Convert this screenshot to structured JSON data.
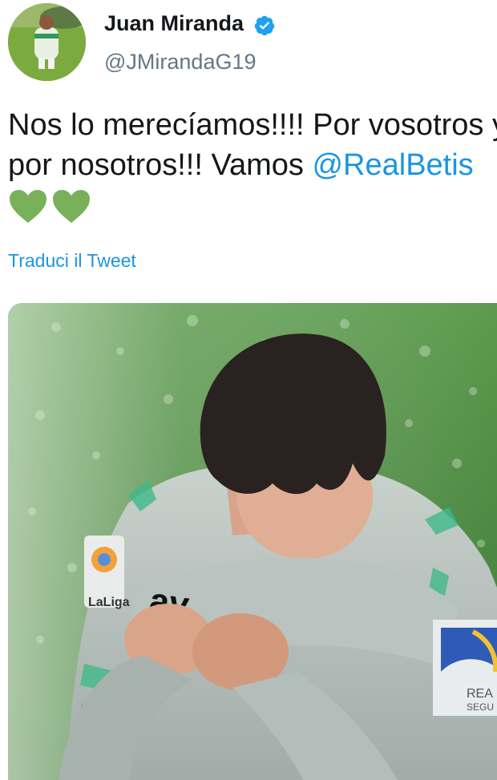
{
  "author": {
    "display_name": "Juan Miranda",
    "handle": "@JMirandaG19",
    "verified": true,
    "avatar_icon": "user-avatar-photo"
  },
  "tweet": {
    "text_line1": "Nos lo merecíamos!!!! Por vosotros y",
    "text_line2_prefix": "por nosotros!!! Vamos ",
    "mention": "@RealBetis",
    "emoji": [
      "green-heart-icon",
      "green-heart-icon"
    ],
    "translate_label": "Traduci il Tweet"
  },
  "media": {
    "icon": "tweet-photo",
    "shirt_text": "av",
    "sponsor_text": "REA",
    "sponsor_text2": "SEGU",
    "league_badge": "LaLiga"
  },
  "colors": {
    "link": "#1b95e0",
    "verified": "#1da1f2",
    "heart": "#78b159",
    "secondary_text": "#657786"
  }
}
